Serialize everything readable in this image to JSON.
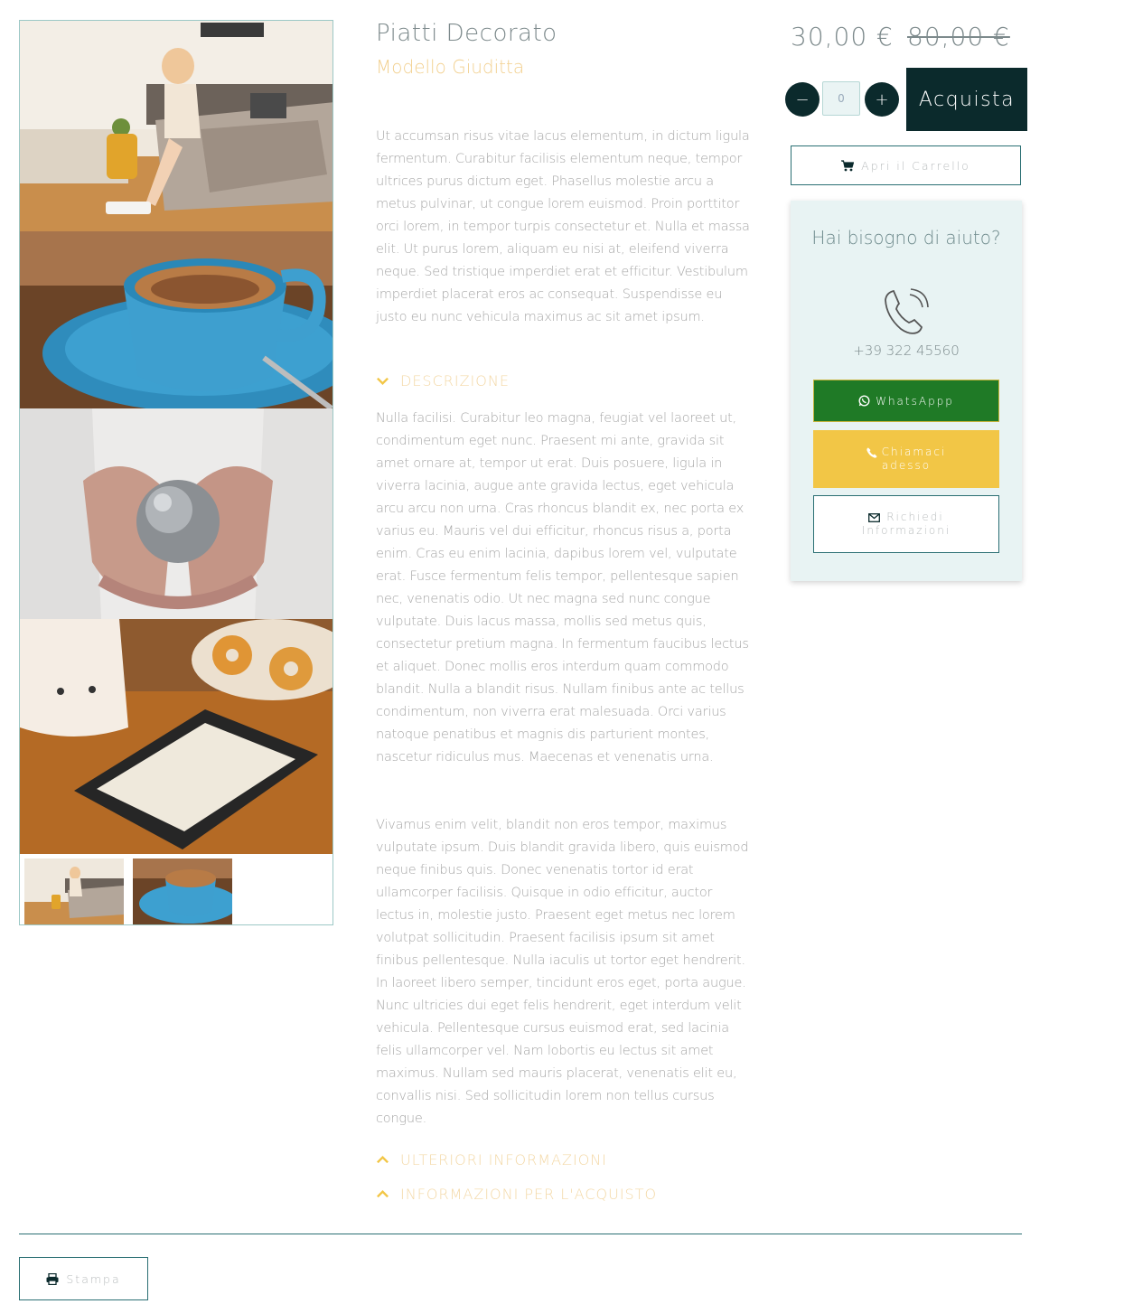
{
  "product": {
    "title": "Piatti Decorato",
    "subtitle": "Modello Giuditta",
    "short_description": "Ut accumsan risus vitae lacus elementum, in dictum ligula fermentum. Curabitur facilisis elementum neque, tempor ultrices purus dictum eget. Phasellus molestie arcu a metus pulvinar, ut congue lorem euismod. Proin porttitor orci lorem, in tempor turpis consectetur et. Nulla et massa elit. Ut purus lorem, aliquam eu nisi at, eleifend viverra neque. Sed tristique imperdiet erat et efficitur. Vestibulum imperdiet placerat eros ac consequat. Suspendisse eu justo eu nunc vehicula maximus ac sit amet ipsum."
  },
  "sections": {
    "description": {
      "label": "DESCRIZIONE",
      "paragraph_1": "Nulla facilisi. Curabitur leo magna, feugiat vel laoreet ut, condimentum eget nunc. Praesent mi ante, gravida sit amet ornare at, tempor ut erat. Duis posuere, ligula in viverra lacinia, augue ante gravida lectus, eget vehicula arcu arcu non urna. Cras rhoncus blandit ex, nec porta ex varius eu. Mauris vel dui efficitur, rhoncus risus a, porta enim. Cras eu enim lacinia, dapibus lorem vel, vulputate erat. Fusce fermentum felis tempor, pellentesque sapien nec, venenatis odio. Ut nec magna sed nunc congue vulputate. Duis lacus massa, mollis sed metus quis, consectetur pretium magna. In fermentum faucibus lectus et aliquet. Donec mollis eros interdum quam commodo blandit. Nulla a blandit risus. Nullam finibus ante ac tellus condimentum, non viverra erat malesuada. Orci varius natoque penatibus et magnis dis parturient montes, nascetur ridiculus mus. Maecenas et venenatis urna.",
      "paragraph_2": "Vivamus enim velit, blandit non eros tempor, maximus vulputate ipsum. Duis blandit gravida libero, quis euismod neque finibus quis. Donec venenatis tortor id erat ullamcorper facilisis. Quisque in odio efficitur, auctor lectus in, molestie justo. Praesent eget metus nec lorem volutpat sollicitudin. Praesent facilisis ipsum sit amet finibus pellentesque. Nulla iaculis ut tortor eget hendrerit. In laoreet libero semper, tincidunt eros eget, porta augue. Nunc ultricies dui eget felis hendrerit, eget interdum velit vehicula. Pellentesque cursus euismod erat, sed lacinia felis ullamcorper vel. Nam lobortis eu lectus sit amet maximus. Nullam sed mauris placerat, venenatis elit eu, convallis nisi. Sed sollicitudin lorem non tellus cursus congue."
    },
    "more_info": {
      "label": "ULTERIORI INFORMAZIONI"
    },
    "purchase_info": {
      "label": "INFORMAZIONI PER L'ACQUISTO"
    }
  },
  "pricing": {
    "current": "30,00 €",
    "old": "80,00 €"
  },
  "cart": {
    "minus_label": "−",
    "plus_label": "+",
    "quantity_value": "0",
    "buy_label": "Acquista",
    "open_cart_label": "Apri il Carrello"
  },
  "help": {
    "title": "Hai bisogno di aiuto?",
    "phone": "+39 322 45560",
    "whatsapp_label": "WhatsAppp",
    "call_line_1": "Chiamaci",
    "call_line_2": "adesso",
    "info_line_1": "Richiedi",
    "info_line_2": "Informazioni"
  },
  "footer": {
    "print_label": "Stampa"
  },
  "icons": {
    "chevron": "chevron-down-icon",
    "cart": "shopping-cart-icon",
    "phone": "phone-icon",
    "whatsapp": "whatsapp-icon",
    "envelope": "envelope-icon",
    "print": "printer-icon"
  },
  "colors": {
    "dark_teal": "#0b2a2c",
    "accent_gold": "#f2d08f",
    "whatsapp_green": "#1f7a26",
    "call_yellow": "#f2c646",
    "help_bg": "#e8f3f3"
  }
}
